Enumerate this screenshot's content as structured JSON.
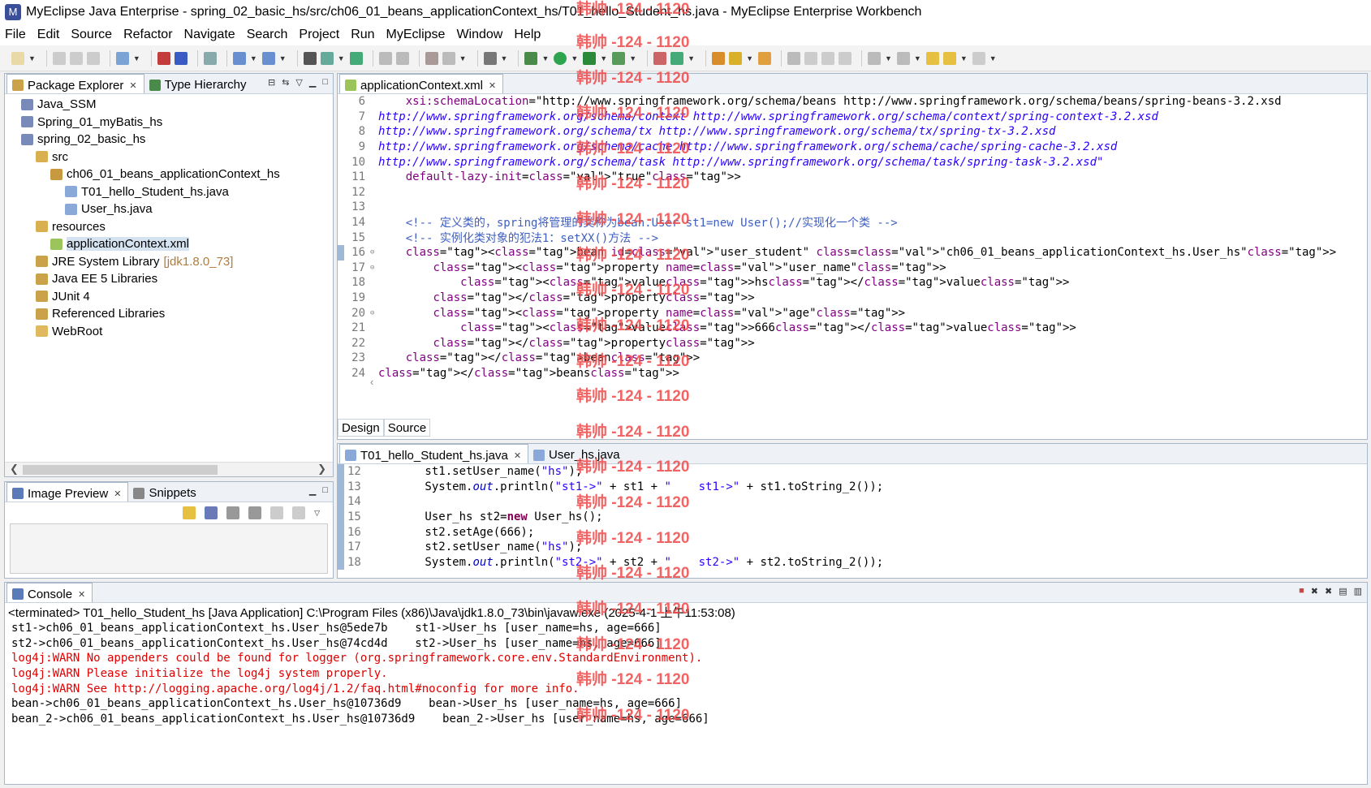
{
  "window": {
    "title": "MyEclipse Java Enterprise - spring_02_basic_hs/src/ch06_01_beans_applicationContext_hs/T01_hello_Student_hs.java - MyEclipse Enterprise Workbench"
  },
  "menu": [
    "File",
    "Edit",
    "Source",
    "Refactor",
    "Navigate",
    "Search",
    "Project",
    "Run",
    "MyEclipse",
    "Window",
    "Help"
  ],
  "explorer": {
    "tabs": [
      {
        "label": "Package Explorer"
      },
      {
        "label": "Type Hierarchy"
      }
    ],
    "items": [
      {
        "label": "Java_SSM",
        "extra": ""
      },
      {
        "label": "Spring_01_myBatis_hs",
        "extra": ""
      },
      {
        "label": "spring_02_basic_hs",
        "extra": ""
      },
      {
        "label": "src",
        "extra": ""
      },
      {
        "label": "ch06_01_beans_applicationContext_hs",
        "extra": ""
      },
      {
        "label": "T01_hello_Student_hs.java",
        "extra": ""
      },
      {
        "label": "User_hs.java",
        "extra": ""
      },
      {
        "label": "resources",
        "extra": ""
      },
      {
        "label": "applicationContext.xml",
        "extra": ""
      },
      {
        "label": "JRE System Library",
        "extra": "[jdk1.8.0_73]"
      },
      {
        "label": "Java EE 5 Libraries",
        "extra": ""
      },
      {
        "label": "JUnit 4",
        "extra": ""
      },
      {
        "label": "Referenced Libraries",
        "extra": ""
      },
      {
        "label": "WebRoot",
        "extra": ""
      }
    ]
  },
  "preview": {
    "tabs": [
      {
        "label": "Image Preview"
      },
      {
        "label": "Snippets"
      }
    ]
  },
  "xml_editor": {
    "tab": "applicationContext.xml",
    "bottom_tabs": [
      "Design",
      "Source"
    ],
    "lines": [
      {
        "n": "6",
        "text": "    xsi:schemaLocation=\"http://www.springframework.org/schema/beans http://www.springframework.org/schema/beans/spring-beans-3.2.xsd"
      },
      {
        "n": "7",
        "text": "http://www.springframework.org/schema/context http://www.springframework.org/schema/context/spring-context-3.2.xsd"
      },
      {
        "n": "8",
        "text": "http://www.springframework.org/schema/tx http://www.springframework.org/schema/tx/spring-tx-3.2.xsd"
      },
      {
        "n": "9",
        "text": "http://www.springframework.org/schema/cache http://www.springframework.org/schema/cache/spring-cache-3.2.xsd"
      },
      {
        "n": "10",
        "text": "http://www.springframework.org/schema/task http://www.springframework.org/schema/task/spring-task-3.2.xsd\""
      },
      {
        "n": "11",
        "text": "    default-lazy-init=\"true\">"
      },
      {
        "n": "12",
        "text": ""
      },
      {
        "n": "13",
        "text": ""
      },
      {
        "n": "14",
        "text": "    <!-- 定义类的，spring将管理的类称为bean.User st1=new User();//实现化一个类 -->"
      },
      {
        "n": "15",
        "text": "    <!-- 实例化类对象的犯法1：setXX()方法 -->"
      },
      {
        "n": "16",
        "text": "    <bean id=\"user_student\" class=\"ch06_01_beans_applicationContext_hs.User_hs\">"
      },
      {
        "n": "17",
        "text": "        <property name=\"user_name\">"
      },
      {
        "n": "18",
        "text": "            <value>hs</value>"
      },
      {
        "n": "19",
        "text": "        </property>"
      },
      {
        "n": "20",
        "text": "        <property name=\"age\">"
      },
      {
        "n": "21",
        "text": "            <value>666</value>"
      },
      {
        "n": "22",
        "text": "        </property>"
      },
      {
        "n": "23",
        "text": "    </bean>"
      },
      {
        "n": "24",
        "text": "</beans>"
      }
    ]
  },
  "java_editor": {
    "tabs": [
      "T01_hello_Student_hs.java",
      "User_hs.java"
    ],
    "lines": [
      {
        "n": "12",
        "text": "        st1.setUser_name(\"hs\");"
      },
      {
        "n": "13",
        "text": "        System.out.println(\"st1->\" + st1 + \"    st1->\" + st1.toString_2());"
      },
      {
        "n": "14",
        "text": ""
      },
      {
        "n": "15",
        "text": "        User_hs st2=new User_hs();"
      },
      {
        "n": "16",
        "text": "        st2.setAge(666);"
      },
      {
        "n": "17",
        "text": "        st2.setUser_name(\"hs\");"
      },
      {
        "n": "18",
        "text": "        System.out.println(\"st2->\" + st2 + \"    st2->\" + st2.toString_2());"
      }
    ]
  },
  "console": {
    "tab": "Console",
    "status": "<terminated> T01_hello_Student_hs [Java Application] C:\\Program Files (x86)\\Java\\jdk1.8.0_73\\bin\\javaw.exe (2025-4-1 上午11:53:08)",
    "lines": [
      {
        "text": "st1->ch06_01_beans_applicationContext_hs.User_hs@5ede7b    st1->User_hs [user_name=hs, age=666]",
        "err": false
      },
      {
        "text": "st2->ch06_01_beans_applicationContext_hs.User_hs@74cd4d    st2->User_hs [user_name=hs, age=666]",
        "err": false
      },
      {
        "text": "log4j:WARN No appenders could be found for logger (org.springframework.core.env.StandardEnvironment).",
        "err": true
      },
      {
        "text": "log4j:WARN Please initialize the log4j system properly.",
        "err": true
      },
      {
        "text": "log4j:WARN See http://logging.apache.org/log4j/1.2/faq.html#noconfig for more info.",
        "err": true
      },
      {
        "text": "bean->ch06_01_beans_applicationContext_hs.User_hs@10736d9    bean->User_hs [user_name=hs, age=666]",
        "err": false
      },
      {
        "text": "bean_2->ch06_01_beans_applicationContext_hs.User_hs@10736d9    bean_2->User_hs [user_name=hs, age=666]",
        "err": false
      }
    ]
  },
  "watermark": "韩帅 -124 - 1120"
}
